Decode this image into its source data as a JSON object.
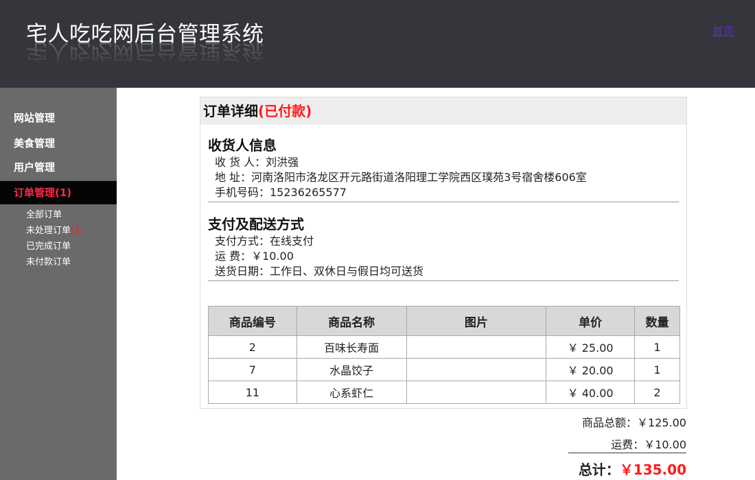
{
  "header": {
    "title": "宅人吃吃网后台管理系统",
    "home_link": "首页"
  },
  "sidebar": {
    "items": [
      {
        "label": "网站管理"
      },
      {
        "label": "美食管理"
      },
      {
        "label": "用户管理"
      },
      {
        "label": "订单管理(1)"
      }
    ],
    "sub_items": [
      {
        "label": "全部订单",
        "count": ""
      },
      {
        "label": "未处理订单",
        "count": "(1)"
      },
      {
        "label": "已完成订单",
        "count": ""
      },
      {
        "label": "未付款订单",
        "count": ""
      }
    ]
  },
  "order": {
    "title": "订单详细",
    "status": "(已付款)",
    "receiver": {
      "heading": "收货人信息",
      "name": "收 货 人：刘洪强",
      "address": "地 址：河南洛阳市洛龙区开元路街道洛阳理工学院西区璞苑3号宿舍楼606室",
      "phone": "手机号码：15236265577"
    },
    "payment": {
      "heading": "支付及配送方式",
      "method": "支付方式：在线支付",
      "shipping": "运 费：￥10.00",
      "delivery": "送货日期：工作日、双休日与假日均可送货"
    },
    "table": {
      "headers": [
        "商品编号",
        "商品名称",
        "图片",
        "单价",
        "数量"
      ],
      "rows": [
        [
          "2",
          "百味长寿面",
          "",
          "￥ 25.00",
          "1"
        ],
        [
          "7",
          "水晶饺子",
          "",
          "￥ 20.00",
          "1"
        ],
        [
          "11",
          "心系虾仁",
          "",
          "￥ 40.00",
          "2"
        ]
      ]
    },
    "totals": {
      "subtotal": "商品总额：￥125.00",
      "shipping": "运费：￥10.00",
      "total_label": "总计：",
      "total_amount": "￥135.00"
    }
  },
  "colors": {
    "header_bg": "#34363c",
    "sidebar_bg": "#6a6a6a",
    "active_item_bg": "#050505",
    "active_item_text": "#ff2a4a",
    "accent_red": "#ff1a1a",
    "link": "#5a2fb8"
  }
}
